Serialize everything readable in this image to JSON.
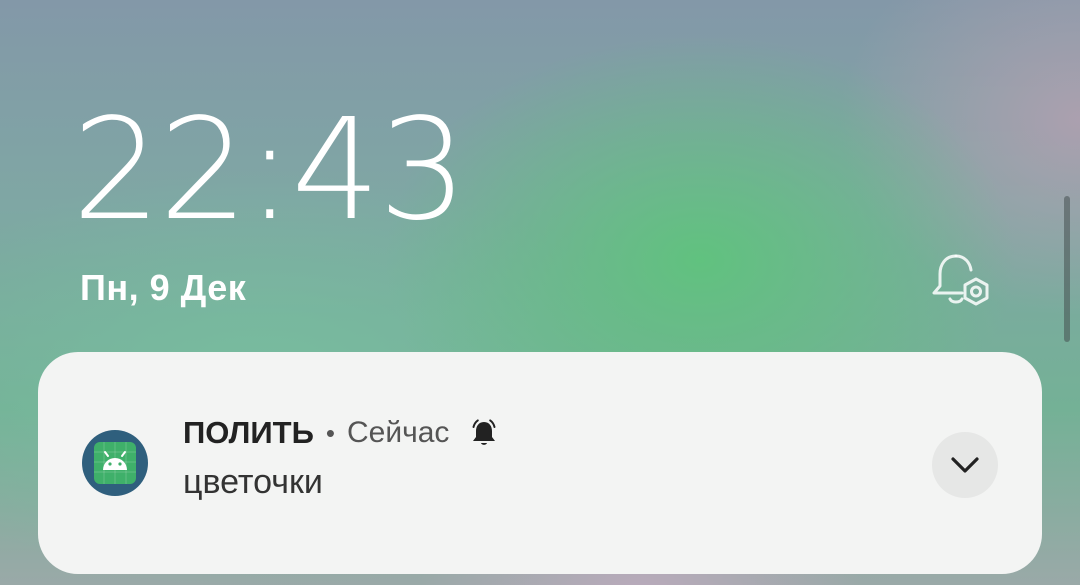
{
  "lockscreen": {
    "time": "22:43",
    "date": "Пн, 9 Дек",
    "icons": {
      "notification_settings": "bell-settings-icon"
    }
  },
  "notification": {
    "app_name": "ПОЛИТЬ",
    "separator": "•",
    "timestamp": "Сейчас",
    "message": "цветочки",
    "icons": {
      "app": "android-app-icon",
      "alert": "bell-alert-icon",
      "expand": "chevron-down-icon"
    }
  },
  "colors": {
    "card_background": "#f3f4f3",
    "text_primary": "#222222",
    "text_secondary": "#555555",
    "app_icon_ring": "#2f5f7d",
    "app_icon_fill": "#3fb06a"
  }
}
